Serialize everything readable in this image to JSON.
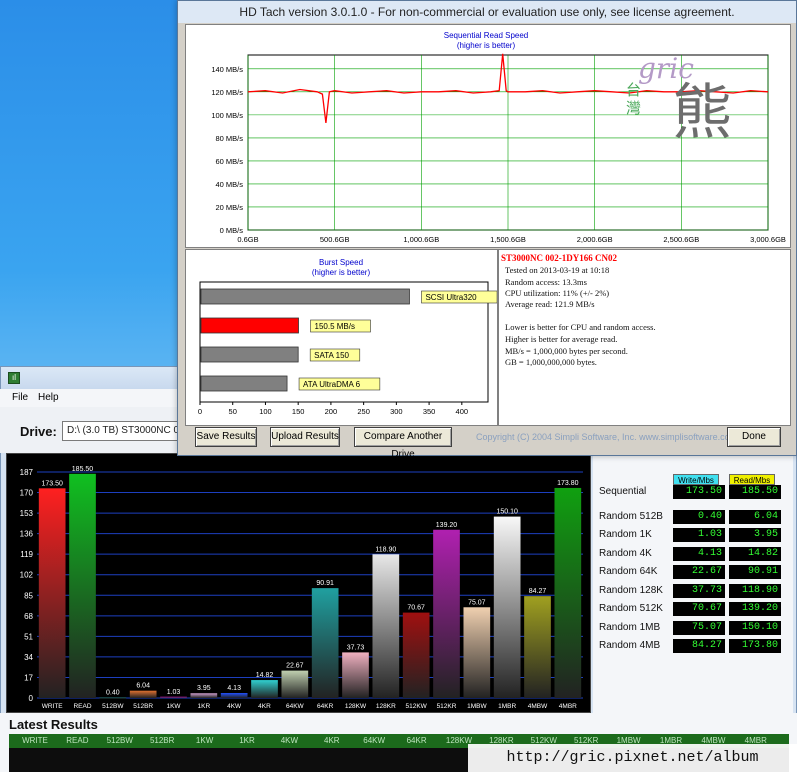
{
  "hdtach": {
    "title": "HD Tach version 3.0.1.0  - For non-commercial or evaluation use only, see license agreement.",
    "seq_title": "Sequential Read Speed",
    "seq_subtitle": "(higher is better)",
    "burst_title": "Burst Speed",
    "burst_subtitle": "(higher is better)",
    "info_drive": "ST3000NC 002-1DY166 CN02",
    "info_lines": [
      "Tested on 2013-03-19 at 10:18",
      "Random access: 13.3ms",
      "CPU utilization: 11% (+/- 2%)",
      "Average read: 121.9 MB/s"
    ],
    "info_notes": [
      "Lower is better for CPU and random access.",
      "Higher is better for average read.",
      "MB/s = 1,000,000 bytes per second.",
      "GB = 1,000,000,000 bytes."
    ],
    "buttons": {
      "save": "Save Results",
      "upload": "Upload Results",
      "compare": "Compare Another Drive",
      "done": "Done"
    },
    "copyright": "Copyright (C) 2004 Simpli Software, Inc. www.simplisoftware.com",
    "watermark_latin": "gric",
    "watermark_cjk_small": "台灣",
    "watermark_cjk_big": "熊",
    "colors": {
      "line": "#ff0000",
      "grid": "#00a000",
      "burst_bar": "#ff0000",
      "ref_bar": "#808080",
      "label_bg": "#ffff99"
    }
  },
  "benchmark": {
    "menu": [
      "File",
      "Help"
    ],
    "drive_label": "Drive:",
    "drive_value": "D:\\ (3.0 TB) ST3000NC 00",
    "stats_headers": {
      "write": "Write/Mbs",
      "read": "Read/Mbs"
    },
    "stats": [
      {
        "label": "Sequential",
        "write": "173.50",
        "read": "185.50"
      },
      {
        "label": "Random 512B",
        "write": "0.40",
        "read": "6.04"
      },
      {
        "label": "Random 1K",
        "write": "1.03",
        "read": "3.95"
      },
      {
        "label": "Random 4K",
        "write": "4.13",
        "read": "14.82"
      },
      {
        "label": "Random 64K",
        "write": "22.67",
        "read": "90.91"
      },
      {
        "label": "Random 128K",
        "write": "37.73",
        "read": "118.90"
      },
      {
        "label": "Random 512K",
        "write": "70.67",
        "read": "139.20"
      },
      {
        "label": "Random 1MB",
        "write": "75.07",
        "read": "150.10"
      },
      {
        "label": "Random 4MB",
        "write": "84.27",
        "read": "173.80"
      }
    ],
    "latest_title": "Latest Results",
    "latest_headers": [
      "WRITE",
      "READ",
      "512BW",
      "512BR",
      "1KW",
      "1KR",
      "4KW",
      "4KR",
      "64KW",
      "64KR",
      "128KW",
      "128KR",
      "512KW",
      "512KR",
      "1MBW",
      "1MBR",
      "4MBW",
      "4MBR"
    ],
    "watermark_url": "http://gric.pixnet.net/album"
  },
  "chart_data": [
    {
      "type": "line",
      "title": "Sequential Read Speed",
      "subtitle": "(higher is better)",
      "x_ticks": [
        "0.6GB",
        "500.6GB",
        "1,000.6GB",
        "1,500.6GB",
        "2,000.6GB",
        "2,500.6GB",
        "3,000.6GB"
      ],
      "y_ticks": [
        "0 MB/s",
        "20 MB/s",
        "40 MB/s",
        "60 MB/s",
        "80 MB/s",
        "100 MB/s",
        "120 MB/s",
        "140 MB/s"
      ],
      "xlim": [
        0.6,
        3000.6
      ],
      "ylim": [
        0,
        152
      ],
      "series": [
        {
          "x": [
            0.6,
            100,
            200,
            300,
            400,
            430,
            450,
            470,
            500,
            600,
            700,
            800,
            900,
            1000,
            1100,
            1200,
            1300,
            1400,
            1450,
            1470,
            1490,
            1500,
            1600,
            1700,
            1800,
            1900,
            2000,
            2100,
            2200,
            2300,
            2400,
            2500,
            2600,
            2700,
            2800,
            2900,
            3000.6
          ],
          "y": [
            120,
            121,
            119,
            122,
            120,
            118,
            93,
            120,
            121,
            119,
            120,
            121,
            119,
            120,
            120,
            121,
            119,
            120,
            121,
            153,
            121,
            120,
            120,
            121,
            119,
            120,
            121,
            120,
            119,
            121,
            120,
            120,
            121,
            120,
            119,
            121,
            120
          ]
        }
      ]
    },
    {
      "type": "bar",
      "title": "Burst Speed",
      "subtitle": "(higher is better)",
      "categories": [
        "SCSI Ultra320",
        "150.5 MB/s",
        "SATA 150",
        "ATA UltraDMA 6"
      ],
      "values": [
        320,
        150.5,
        150,
        133
      ],
      "x_ticks": [
        0,
        50,
        100,
        150,
        200,
        250,
        300,
        350,
        400
      ],
      "xlim": [
        0,
        440
      ]
    },
    {
      "type": "bar",
      "categories": [
        "WRITE",
        "READ",
        "512BW",
        "512BR",
        "1KW",
        "1KR",
        "4KW",
        "4KR",
        "64KW",
        "64KR",
        "128KW",
        "128KR",
        "512KW",
        "512KR",
        "1MBW",
        "1MBR",
        "4MBW",
        "4MBR"
      ],
      "values": [
        173.5,
        185.5,
        0.4,
        6.04,
        1.03,
        3.95,
        4.13,
        14.82,
        22.67,
        90.91,
        37.73,
        118.9,
        70.67,
        139.2,
        75.07,
        150.1,
        84.27,
        173.8
      ],
      "value_labels": [
        "173.50",
        "185.50",
        "0.40",
        "6.04",
        "1.03",
        "3.95",
        "4.13",
        "14.82",
        "22.67",
        "90.91",
        "37.73",
        "118.90",
        "70.67",
        "139.20",
        "75.07",
        "150.10",
        "84.27",
        "173.80"
      ],
      "y_ticks": [
        "0",
        "17",
        "34",
        "51",
        "68",
        "85",
        "102",
        "119",
        "136",
        "153",
        "170",
        "187"
      ],
      "ylim": [
        0,
        187
      ],
      "colors": [
        "#ff2020",
        "#10c020",
        "#30a0a0",
        "#e07030",
        "#d020d0",
        "#d0a0d0",
        "#2050ff",
        "#30d0d0",
        "#c0d0b0",
        "#20a0a0",
        "#f0b0c0",
        "#e8e8e8",
        "#a01010",
        "#b020b0",
        "#f0d0b0",
        "#f8f8f8",
        "#a0a020",
        "#10a010"
      ]
    }
  ]
}
